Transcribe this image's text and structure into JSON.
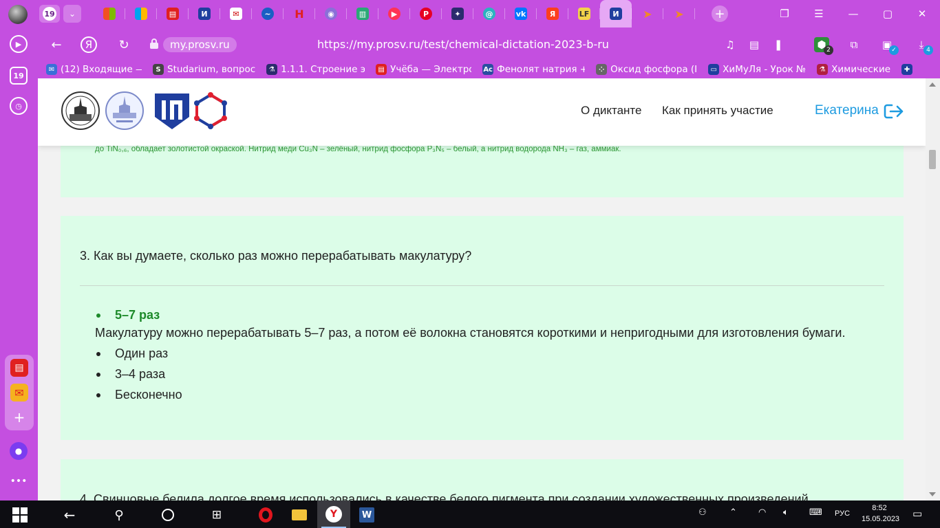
{
  "browser": {
    "tab_count": "19",
    "address": {
      "domain": "my.prosv.ru",
      "url": "https://my.prosv.ru/test/chemical-dictation-2023-b-ru"
    },
    "downloads_badge": "4",
    "ext_badge": "2",
    "bookmarks": [
      {
        "label": "(12) Входящие — ",
        "icon": "mail-icon",
        "color": "#3a6fd8"
      },
      {
        "label": "Studarium, вопрос",
        "icon": "studarium-icon",
        "color": "#444444"
      },
      {
        "label": "1.1.1. Строение эл",
        "icon": "flask-icon",
        "color": "#2b2b6e"
      },
      {
        "label": "Учёба — Электрон",
        "icon": "doc-icon",
        "color": "#e02020"
      },
      {
        "label": "Фенолят натрия +",
        "icon": "chem-icon",
        "color": "#2a4fa0"
      },
      {
        "label": "Оксид фосфора (I",
        "icon": "dots-icon",
        "color": "#666666"
      },
      {
        "label": "ХиМуЛя - Урок №",
        "icon": "window-icon",
        "color": "#1f3e9e"
      },
      {
        "label": "Химические",
        "icon": "beaker-icon",
        "color": "#b01f3f"
      },
      {
        "label": "",
        "icon": "uk-flag-icon",
        "color": "#1f3e9e"
      }
    ]
  },
  "site": {
    "nav": {
      "about": "О диктанте",
      "how_to": "Как принять участие"
    },
    "user_name": "Екатерина",
    "accent": "#1d9be0"
  },
  "content": {
    "prev_explanation": "до TiN₀,₆, обладает золотистой окраской. Нитрид меди Cu₃N – зелёный, нитрид фосфора P₃N₅ – белый, а нитрид водорода NH₃ – газ, аммиак.",
    "question3": {
      "title": "3. Как вы думаете, сколько раз можно перерабатывать макулатуру?",
      "correct_answer": "5–7 раз",
      "explanation": "Макулатуру можно перерабатывать 5–7 раз, а потом её волокна становятся короткими и непригодными для изготовления бумаги.",
      "other_answers": [
        "Один раз",
        "3–4 раза",
        "Бесконечно"
      ]
    },
    "question4_partial": "4. Свинцовые белила долгое время использовались в качестве белого пигмента при создании художественных произведений."
  },
  "taskbar": {
    "lang": "РУС",
    "time": "8:52",
    "date": "15.05.2023"
  },
  "colors": {
    "browser_purple": "#c44fe0",
    "card_green": "#dcfde8",
    "correct_green": "#1d8a2a"
  }
}
